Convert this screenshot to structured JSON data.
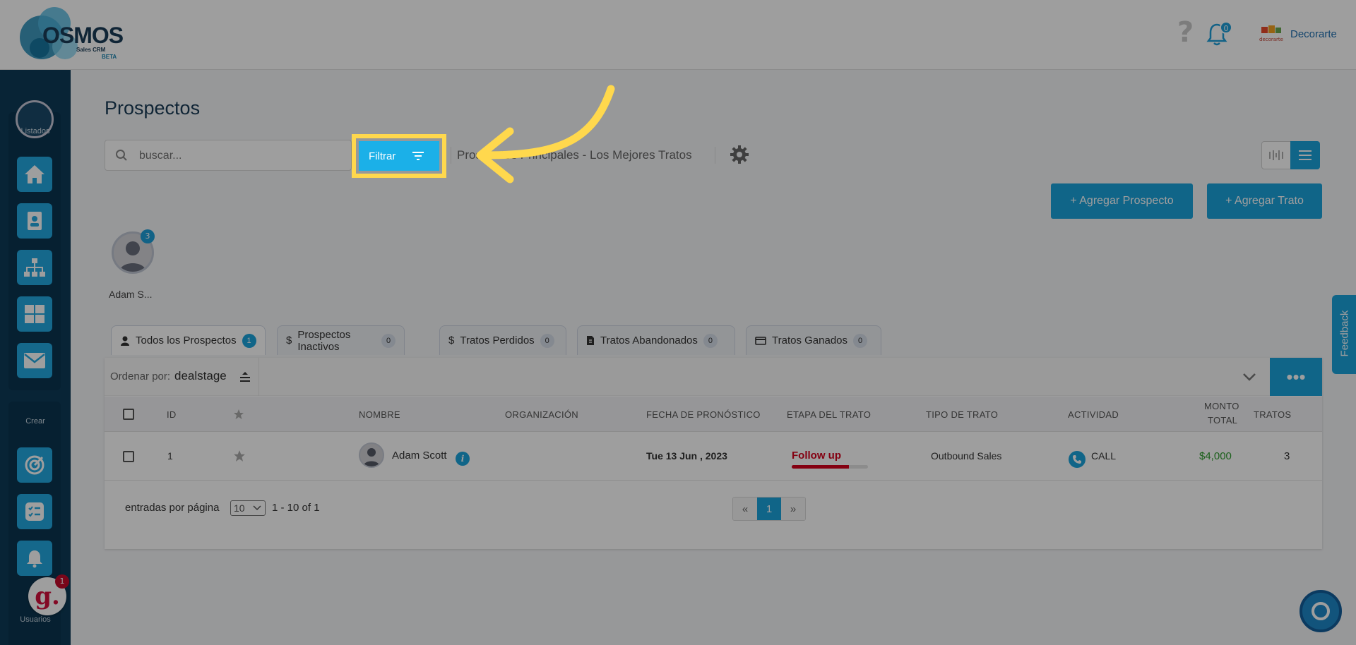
{
  "topbar": {
    "logo_text": "OSMOS",
    "logo_sub": "Sales CRM",
    "logo_beta": "BETA",
    "notification_count": "0",
    "company_logo_text": "decorarte",
    "company_name": "Decorarte"
  },
  "sidebar": {
    "section_list": "Listados",
    "section_create": "Crear",
    "section_users": "Usuarios",
    "list_items": [
      "home-icon",
      "contact-icon",
      "org-chart-icon",
      "grid-icon",
      "mail-icon"
    ],
    "create_items": [
      "target-icon",
      "checklist-icon",
      "alarm-bell-icon"
    ],
    "grammarly_badge": "1"
  },
  "page": {
    "title": "Prospectos",
    "search_placeholder": "buscar...",
    "filter_label": "Filtrar",
    "pipeline_label": "Prospectos Principales - Los Mejores Tratos",
    "add_prospect_label": "+ Agregar Prospecto",
    "add_deal_label": "+ Agregar Trato"
  },
  "user_chip": {
    "name": "Adam S...",
    "count": "3"
  },
  "tabs": [
    {
      "label": "Todos los Prospectos",
      "count": "1",
      "icon": "user-icon",
      "active": true
    },
    {
      "label": "Prospectos Inactivos",
      "count": "0",
      "icon": "dollar-icon",
      "active": false
    },
    {
      "label": "Tratos Perdidos",
      "count": "0",
      "icon": "dollar-icon",
      "active": false
    },
    {
      "label": "Tratos Abandonados",
      "count": "0",
      "icon": "document-icon",
      "active": false
    },
    {
      "label": "Tratos Ganados",
      "count": "0",
      "icon": "card-icon",
      "active": false
    }
  ],
  "sort": {
    "label": "Ordenar por:",
    "value": "dealstage"
  },
  "table": {
    "headers": {
      "id": "ID",
      "name": "NOMBRE",
      "organization": "ORGANIZACIÓN",
      "forecast_date": "FECHA DE PRONÓSTICO",
      "deal_stage": "ETAPA DEL TRATO",
      "deal_type": "TIPO DE TRATO",
      "activity": "ACTIVIDAD",
      "total_amount_1": "MONTO",
      "total_amount_2": "TOTAL",
      "deals": "TRATOS"
    },
    "rows": [
      {
        "id": "1",
        "name": "Adam Scott",
        "organization": "",
        "forecast_date": "Tue 13 Jun , 2023",
        "deal_stage": "Follow up",
        "stage_progress": 0.75,
        "deal_type": "Outbound Sales",
        "activity": "CALL",
        "total_amount": "$4,000",
        "deals": "3"
      }
    ]
  },
  "footer": {
    "per_page_label": "entradas por página",
    "per_page_value": "10",
    "range": "1 - 10 of 1",
    "prev": "«",
    "current_page": "1",
    "next": "»"
  },
  "feedback_label": "Feedback",
  "colors": {
    "accent": "#1ba3dc",
    "sidebar": "#0d3b57",
    "highlight": "#ffd84d",
    "stage": "#d5001c",
    "amount": "#2e9b2e"
  }
}
